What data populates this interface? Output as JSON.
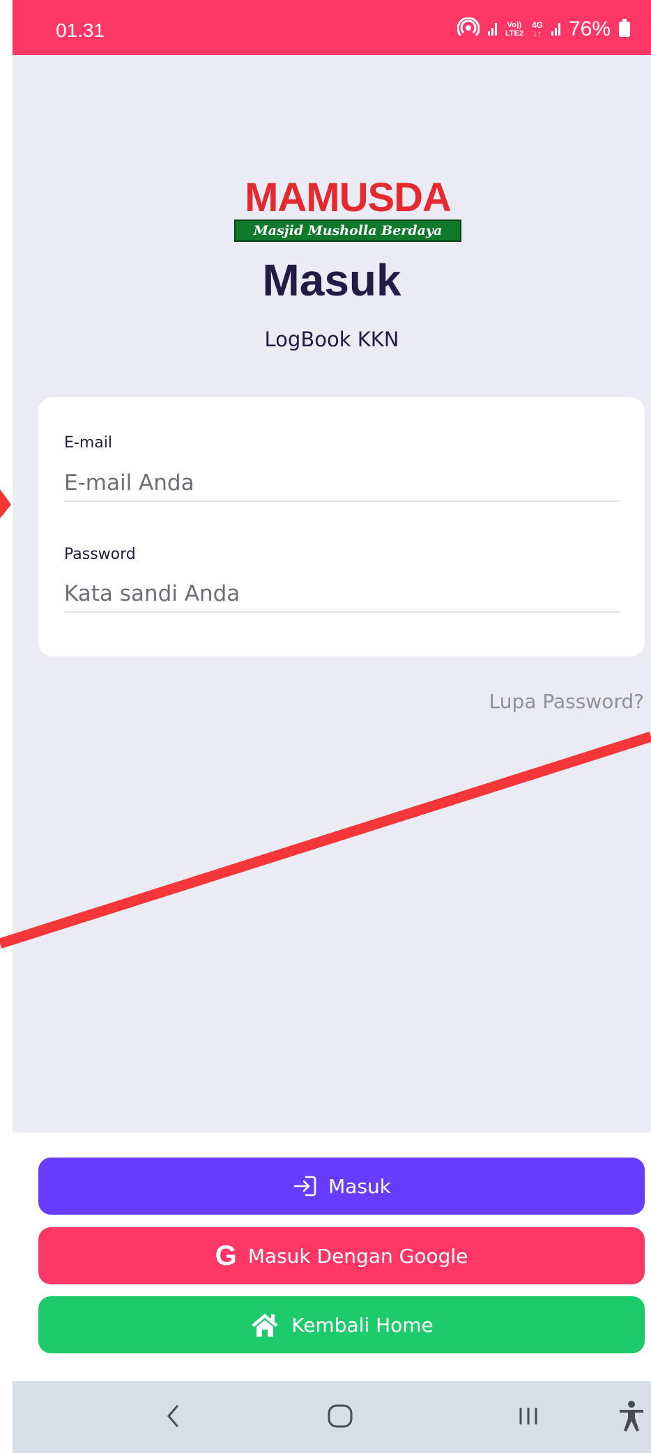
{
  "status_bar": {
    "time": "01.31",
    "network_volte": "Vo))",
    "network_lte": "LTE2",
    "network_4g": "4G",
    "battery": "76%"
  },
  "logo": {
    "wordmark": "MAMUSDA",
    "tagline": "Masjid Musholla Berdaya"
  },
  "header": {
    "title": "Masuk",
    "subtitle": "LogBook KKN"
  },
  "form": {
    "email_label": "E-mail",
    "email_placeholder": "E-mail Anda",
    "email_value": "",
    "password_label": "Password",
    "password_placeholder": "Kata sandi Anda",
    "password_value": ""
  },
  "forgot_password": "Lupa Password?",
  "actions": {
    "login_label": "Masuk",
    "google_label": "Masuk Dengan Google",
    "home_label": "Kembali Home"
  },
  "colors": {
    "status_bar": "#fe3767",
    "primary": "#663cfe",
    "google": "#fe3767",
    "home": "#1ecb6b",
    "annotation": "#f6373a"
  },
  "icons": {
    "login": "login-arrow-icon",
    "google": "google-g-icon",
    "home": "home-icon",
    "nav_back": "chevron-left-icon",
    "nav_home": "rounded-square-icon",
    "nav_recents": "three-bars-icon",
    "accessibility": "accessibility-icon"
  }
}
